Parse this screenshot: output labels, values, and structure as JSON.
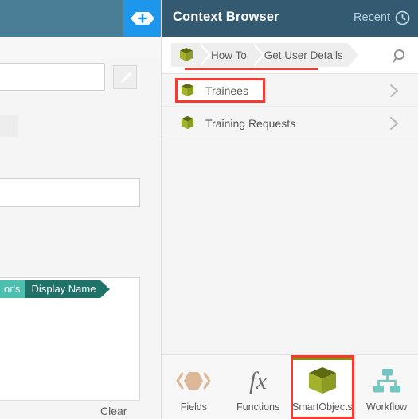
{
  "colors": {
    "panel_header_bg": "#335a70",
    "app_topbar_bg": "#4a7d96",
    "add_button_bg": "#1e96ec",
    "highlight_red": "#f63a32",
    "smartobject_olive": "#8b9b23",
    "smartobject_olive_dark": "#5d6a12",
    "tab_active_bar": "#8b8f12",
    "fields_icon": "#dcb898",
    "workflow_icon": "#72c7c0",
    "token_prefix_bg": "#4bc0ae",
    "token_main_bg": "#1f7268"
  },
  "background_app": {
    "add_button_name": "add",
    "dropdown": {
      "value": "",
      "placeholder": ""
    },
    "edit_button_name": "edit",
    "text_field": {
      "value": "",
      "placeholder": ""
    },
    "token": {
      "prefix": "or's",
      "label": "Display Name"
    },
    "clear_label": "Clear"
  },
  "context_browser": {
    "title": "Context Browser",
    "recent_label": "Recent",
    "recent_icon": "clock-icon",
    "search_icon": "search-icon",
    "breadcrumb": {
      "root_icon": "smartobject-cube-icon",
      "items": [
        {
          "label": "How To"
        },
        {
          "label": "Get User Details"
        }
      ]
    },
    "list": [
      {
        "label": "Trainees",
        "icon": "smartobject-cube-icon",
        "chevron": "chevron-right-icon",
        "highlighted": true
      },
      {
        "label": "Training Requests",
        "icon": "smartobject-cube-icon",
        "chevron": "chevron-right-icon",
        "highlighted": false
      }
    ],
    "tabs": [
      {
        "label": "Fields",
        "icon": "fields-hexagon-icon",
        "active": false,
        "highlighted": false
      },
      {
        "label": "Functions",
        "icon": "fx-icon",
        "active": false,
        "highlighted": false
      },
      {
        "label": "SmartObjects",
        "icon": "smartobject-cube-icon",
        "active": true,
        "highlighted": true
      },
      {
        "label": "Workflow",
        "icon": "workflow-tree-icon",
        "active": false,
        "highlighted": false
      }
    ]
  }
}
